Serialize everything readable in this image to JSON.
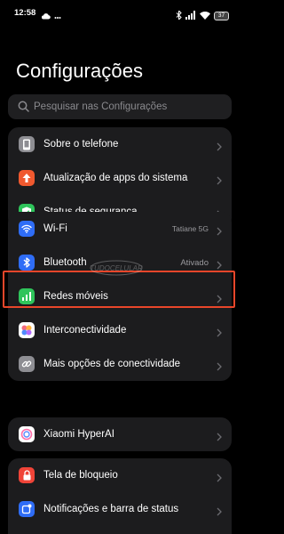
{
  "status_bar": {
    "time": "12:58",
    "battery_level": "37",
    "icons": [
      "cloud-icon",
      "dots-icon",
      "bluetooth-icon",
      "signal-icon",
      "wifi-icon",
      "battery-icon"
    ]
  },
  "page": {
    "title": "Configurações"
  },
  "search": {
    "placeholder": "Pesquisar nas Configurações"
  },
  "groups": [
    {
      "items": [
        {
          "label": "Sobre o telefone",
          "icon": "phone-icon",
          "icon_color": "#8e8e93"
        },
        {
          "label": "Atualização de apps do sistema",
          "icon": "arrow-up-icon",
          "icon_color": "#f0592f"
        },
        {
          "label": "Status de segurança",
          "icon": "shield-check-icon",
          "icon_color": "#2fc45b"
        }
      ]
    },
    {
      "items": [
        {
          "label": "Wi-Fi",
          "value": "Tatiane 5G",
          "icon": "wifi-icon",
          "icon_color": "#2f6df6"
        },
        {
          "label": "Bluetooth",
          "value": "Ativado",
          "icon": "bluetooth-icon",
          "icon_color": "#2f6df6",
          "highlighted": true
        },
        {
          "label": "Redes móveis",
          "icon": "cellular-icon",
          "icon_color": "#2fc45b"
        },
        {
          "label": "Interconectividade",
          "icon": "interconnect-icon",
          "icon_color": "#ffffff"
        },
        {
          "label": "Mais opções de conectividade",
          "icon": "link-icon",
          "icon_color": "#8e8e93"
        }
      ]
    },
    {
      "items": [
        {
          "label": "Xiaomi HyperAI",
          "icon": "hyperai-icon",
          "icon_color": "#ffffff"
        }
      ]
    },
    {
      "items": [
        {
          "label": "Tela de bloqueio",
          "icon": "lock-icon",
          "icon_color": "#f04438"
        },
        {
          "label": "Notificações e barra de status",
          "icon": "notification-icon",
          "icon_color": "#2f6df6"
        }
      ]
    }
  ],
  "highlight_color": "#e8462a"
}
